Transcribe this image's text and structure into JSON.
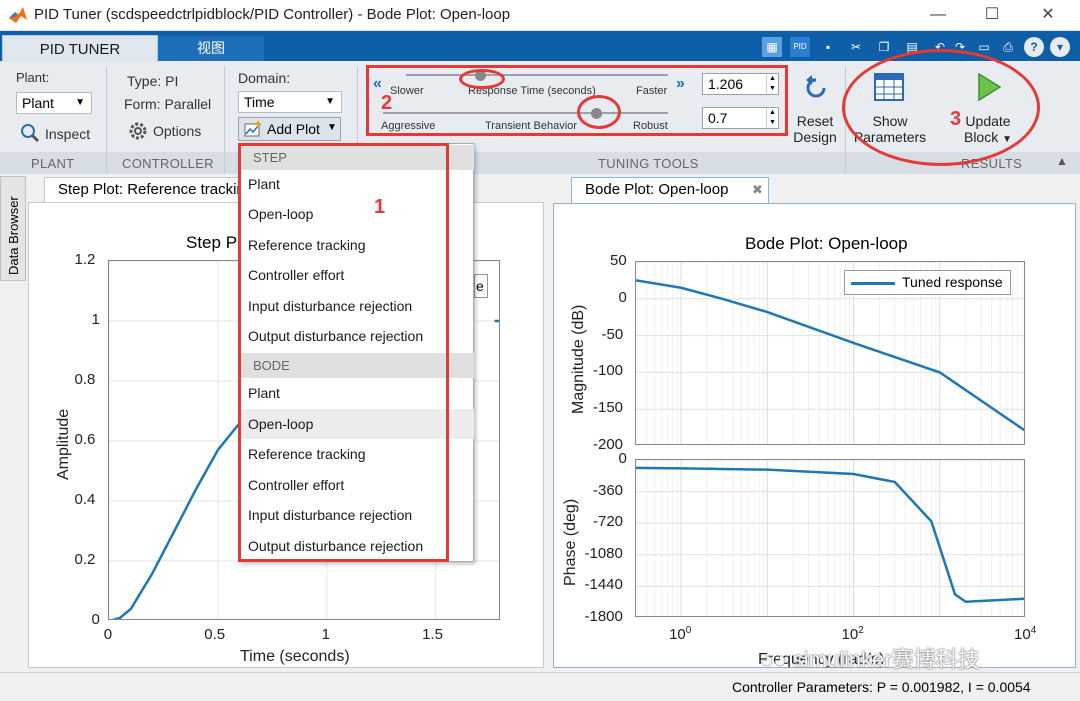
{
  "window": {
    "title": "PID Tuner (scdspeedctrlpidblock/PID Controller) - Bode Plot: Open-loop",
    "minimize": "—",
    "maximize": "☐",
    "close": "✕"
  },
  "tabs": {
    "main": "PID TUNER",
    "view": "视图"
  },
  "plant": {
    "label": "Plant:",
    "value": "Plant",
    "inspect": "Inspect"
  },
  "controller": {
    "type": "Type: PI",
    "form": "Form: Parallel",
    "options": "Options"
  },
  "domain": {
    "label": "Domain:",
    "value": "Time",
    "add_plot": "Add Plot"
  },
  "tuning": {
    "slower": "Slower",
    "response_time": "Response Time (seconds)",
    "faster": "Faster",
    "response_value": "1.206",
    "aggressive": "Aggressive",
    "transient": "Transient Behavior",
    "robust": "Robust",
    "transient_value": "0.7"
  },
  "buttons": {
    "reset_line1": "Reset",
    "reset_line2": "Design",
    "show_line1": "Show",
    "show_line2": "Parameters",
    "update_line1": "Update",
    "update_line2": "Block"
  },
  "sections": {
    "plant": "PLANT",
    "controller": "CONTROLLER",
    "tuning": "TUNING TOOLS",
    "results": "RESULTS"
  },
  "side_tab": "Data Browser",
  "annotations": {
    "a1": "1",
    "a2": "2",
    "a3": "3"
  },
  "menu": {
    "step_header": "STEP",
    "step_items": [
      "Plant",
      "Open-loop",
      "Reference tracking",
      "Controller effort",
      "Input disturbance rejection",
      "Output disturbance rejection"
    ],
    "bode_header": "BODE",
    "bode_items": [
      "Plant",
      "Open-loop",
      "Reference tracking",
      "Controller effort",
      "Input disturbance rejection",
      "Output disturbance rejection"
    ]
  },
  "step_panel": {
    "tab": "Step Plot: Reference tracking",
    "title": "Step P",
    "ylabel": "Amplitude",
    "xlabel": "Time (seconds)",
    "legend_fragment": "e"
  },
  "bode_panel": {
    "tab": "Bode Plot: Open-loop",
    "title": "Bode Plot: Open-loop",
    "mag_label": "Magnitude (dB)",
    "phase_label": "Phase (deg)",
    "xlabel": "Frequency (rad/s)",
    "legend": "Tuned response"
  },
  "watermark": "simulinker赛博科技",
  "status": "Controller Parameters: P = 0.001982, I = 0.0054",
  "colors": {
    "curve": "#1f77b4",
    "ribbon_tab": "#0f5fa8",
    "annotation": "#e53935"
  },
  "chart_data": [
    {
      "type": "line",
      "title": "Step P",
      "xlabel": "Time (seconds)",
      "ylabel": "Amplitude",
      "xlim": [
        0,
        1.8
      ],
      "ylim": [
        0,
        1.2
      ],
      "xticks": [
        "0",
        "0.5",
        "1",
        "1.5"
      ],
      "yticks": [
        "0",
        "0.2",
        "0.4",
        "0.6",
        "0.8",
        "1",
        "1.2"
      ],
      "series": [
        {
          "x": [
            0,
            0.05,
            0.1,
            0.2,
            0.3,
            0.4,
            0.5,
            0.6
          ],
          "y": [
            0,
            0.01,
            0.04,
            0.16,
            0.3,
            0.44,
            0.57,
            0.66
          ]
        },
        {
          "x": [
            1.77,
            1.8
          ],
          "y": [
            1,
            1
          ]
        }
      ]
    },
    {
      "type": "line",
      "title": "Bode Plot: Open-loop",
      "ylabel": "Magnitude (dB)",
      "xscale": "log",
      "xlim": [
        0.3,
        10000
      ],
      "ylim": [
        -200,
        50
      ],
      "yticks": [
        "50",
        "0",
        "-50",
        "-100",
        "-150",
        "-200"
      ],
      "legend": "top-right",
      "series": [
        {
          "name": "Tuned response",
          "x": [
            0.3,
            1,
            3,
            10,
            100,
            1000,
            10000
          ],
          "y": [
            25,
            15,
            0,
            -18,
            -60,
            -100,
            -180
          ]
        }
      ]
    },
    {
      "type": "line",
      "ylabel": "Phase (deg)",
      "xlabel": "Frequency (rad/s)",
      "xscale": "log",
      "xlim": [
        0.3,
        10000
      ],
      "ylim": [
        -1800,
        0
      ],
      "xticks": [
        "10^0",
        "10^2",
        "10^4"
      ],
      "yticks": [
        "0",
        "-360",
        "-720",
        "-1080",
        "-1440",
        "-1800"
      ],
      "series": [
        {
          "name": "Tuned response",
          "x": [
            0.3,
            1,
            10,
            100,
            300,
            800,
            1500,
            2000,
            10000
          ],
          "y": [
            -90,
            -95,
            -110,
            -160,
            -250,
            -700,
            -1530,
            -1615,
            -1580
          ]
        }
      ]
    }
  ]
}
